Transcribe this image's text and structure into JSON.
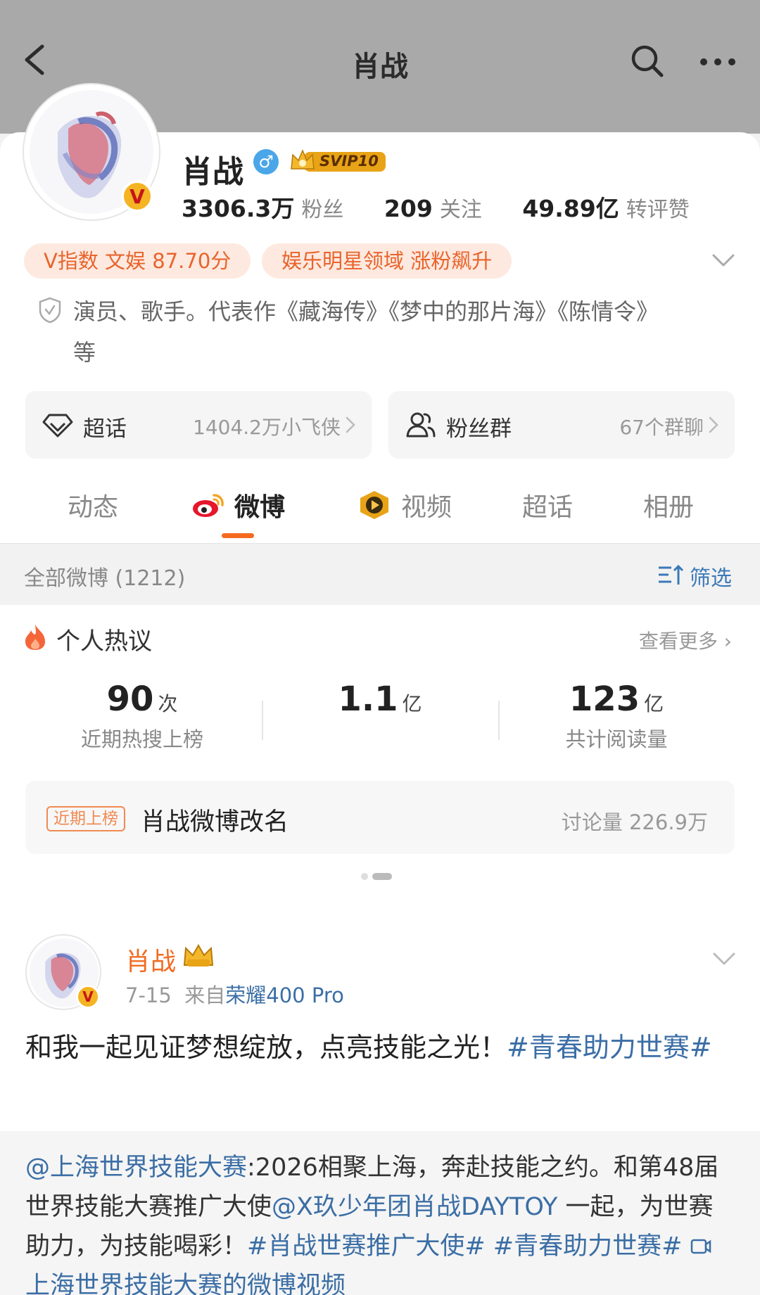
{
  "header": {
    "title": "肖战"
  },
  "profile": {
    "name": "肖战",
    "gender_symbol": "♂",
    "vip_badge": "SVIP10",
    "verified_badge": "V",
    "stats": [
      {
        "value": "3306.3万",
        "label": "粉丝"
      },
      {
        "value": "209",
        "label": "关注"
      },
      {
        "value": "49.89亿",
        "label": "转评赞"
      }
    ],
    "pills": [
      "V指数 文娱 87.70分",
      "娱乐明星领域 涨粉飙升"
    ],
    "bio_line1": "演员、歌手。代表作《藏海传》《梦中的那片海》《陈情令》",
    "bio_line2": "等"
  },
  "shortcuts": [
    {
      "label": "超话",
      "value": "1404.2万小飞侠"
    },
    {
      "label": "粉丝群",
      "value": "67个群聊"
    }
  ],
  "tabs": [
    "动态",
    "微博",
    "视频",
    "超话",
    "相册"
  ],
  "filter": {
    "all": "全部微博 (1212)",
    "filter_label": "筛选"
  },
  "hot": {
    "title": "个人热议",
    "more": "查看更多",
    "metrics": [
      {
        "num": "90",
        "unit": "次",
        "caption": "近期热搜上榜"
      },
      {
        "num": "1.1",
        "unit": "亿",
        "caption": ""
      },
      {
        "num": "123",
        "unit": "亿",
        "caption": "共计阅读量"
      }
    ],
    "rank_tag": "近期上榜",
    "rank_text": "肖战微博改名",
    "rank_discussion": "讨论量 226.9万"
  },
  "post": {
    "name": "肖战",
    "date": "7-15",
    "from": "来自",
    "device": "荣耀400 Pro",
    "text_plain": "和我一起见证梦想绽放，点亮技能之光！",
    "text_tag": "#青春助力世赛#",
    "repost": {
      "mention1": "@上海世界技能大赛",
      "body1": ":2026相聚上海，奔赴技能之约。和第48届世界技能大赛推广大使",
      "mention2": "@X玖少年团肖战DAYTOY",
      "body2": " 一起，为世赛助力，为技能喝彩！",
      "tag1": "#肖战世赛推广大使#",
      "tag2": " #青春助力世赛#",
      "video_link": "上海世界技能大赛的微博视频"
    }
  },
  "colors": {
    "accent": "#f56a1e",
    "link": "#3b6ea5",
    "pill_bg": "#fde9df",
    "header_bg": "#a9a9a9"
  }
}
